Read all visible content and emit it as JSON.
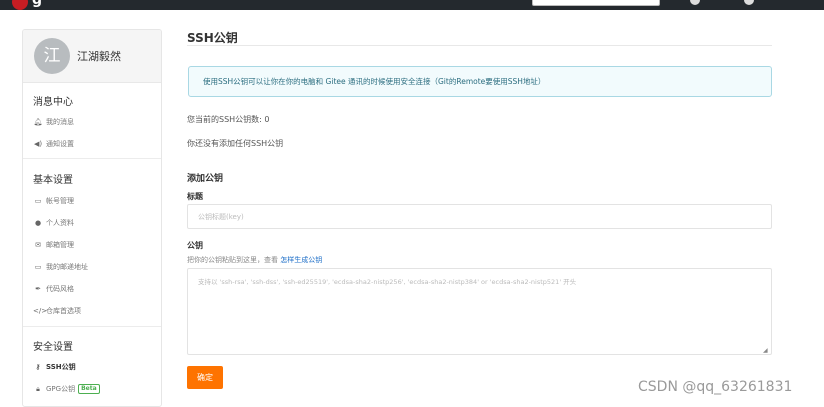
{
  "header": {
    "logo_text": "g"
  },
  "user": {
    "avatar_char": "江",
    "name": "江湖毅然"
  },
  "sidebar": {
    "sections": [
      {
        "title": "消息中心",
        "items": [
          {
            "icon": "bell-icon",
            "glyph": "🔔︎",
            "label": "我的消息"
          },
          {
            "icon": "megaphone-icon",
            "glyph": "◀)",
            "label": "通知设置"
          }
        ]
      },
      {
        "title": "基本设置",
        "items": [
          {
            "icon": "id-card-icon",
            "glyph": "▭",
            "label": "帐号管理"
          },
          {
            "icon": "user-icon",
            "glyph": "●",
            "label": "个人资料"
          },
          {
            "icon": "envelope-icon",
            "glyph": "✉",
            "label": "邮箱管理"
          },
          {
            "icon": "id-card-icon",
            "glyph": "▭",
            "label": "我的邮递地址"
          },
          {
            "icon": "brush-icon",
            "glyph": "✒",
            "label": "代码风格"
          },
          {
            "icon": "code-icon",
            "glyph": "</>",
            "label": "仓库首选项"
          }
        ]
      },
      {
        "title": "安全设置",
        "items": [
          {
            "icon": "key-icon",
            "glyph": "⚷",
            "label": "SSH公钥",
            "active": true
          },
          {
            "icon": "lock-icon",
            "glyph": "🔒︎",
            "label": "GPG公钥",
            "badge": "Beta"
          }
        ]
      }
    ]
  },
  "main": {
    "title": "SSH公钥",
    "info": "使用SSH公钥可以让你在你的电脑和 Gitee 通讯的时候使用安全连接（Git的Remote要使用SSH地址）",
    "count_text": "您当前的SSH公钥数: 0",
    "none_text": "你还没有添加任何SSH公钥",
    "add_heading": "添加公钥",
    "title_label": "标题",
    "title_placeholder": "公钥标题(key)",
    "key_label": "公钥",
    "key_hint_prefix": "把你的公钥粘贴到这里，查看 ",
    "key_hint_link": "怎样生成公钥",
    "key_placeholder": "支持以 'ssh-rsa', 'ssh-dss', 'ssh-ed25519', 'ecdsa-sha2-nistp256', 'ecdsa-sha2-nistp384' or 'ecdsa-sha2-nistp521' 开头",
    "confirm_label": "确定"
  },
  "watermark": "CSDN @qq_63261831",
  "colors": {
    "accent": "#fe7300",
    "link": "#1e6fc8",
    "info_bg": "#f2fbfd",
    "beta": "#4caf50"
  }
}
